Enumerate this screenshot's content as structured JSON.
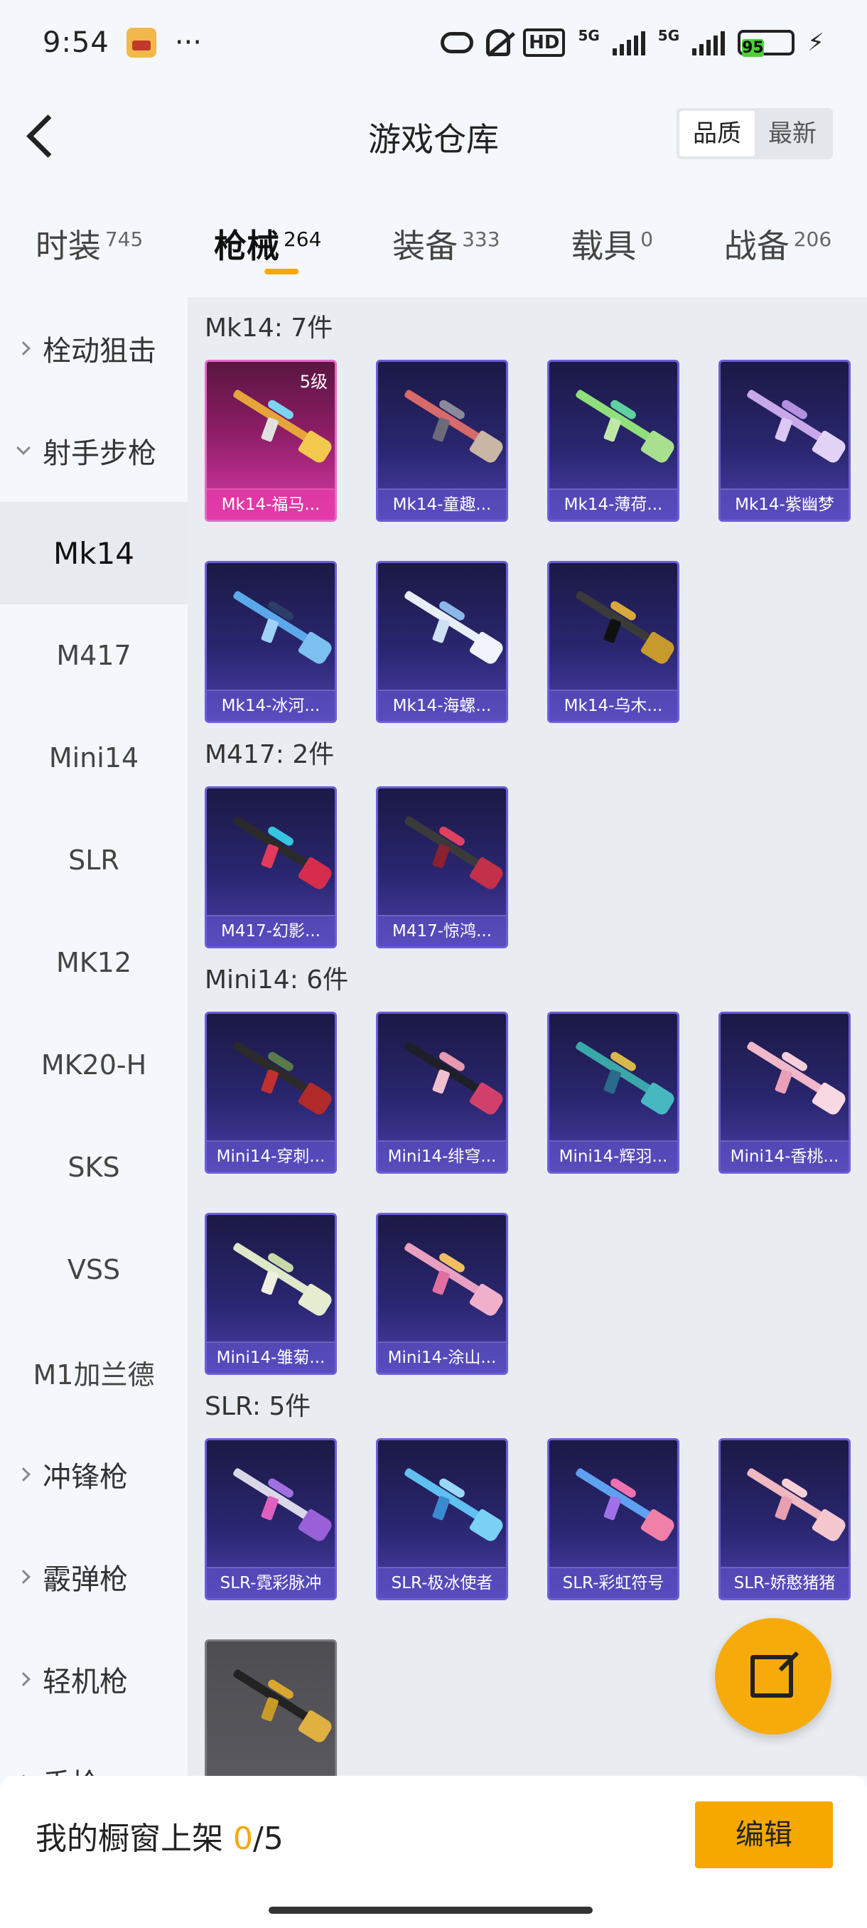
{
  "status_bar": {
    "time": "9:54",
    "dots": "···",
    "net": "5G",
    "battery": "95"
  },
  "header": {
    "title": "游戏仓库",
    "sort": [
      "品质",
      "最新"
    ]
  },
  "tabs": [
    {
      "label": "时装",
      "count": "745"
    },
    {
      "label": "枪械",
      "count": "264"
    },
    {
      "label": "装备",
      "count": "333"
    },
    {
      "label": "载具",
      "count": "0"
    },
    {
      "label": "战备",
      "count": "206"
    }
  ],
  "sidebar": {
    "groups": [
      "栓动狙击",
      "射手步枪"
    ],
    "items": [
      "Mk14",
      "M417",
      "Mini14",
      "SLR",
      "MK12",
      "MK20-H",
      "SKS",
      "VSS",
      "M1加兰德"
    ],
    "more_groups": [
      "冲锋枪",
      "霰弹枪",
      "轻机枪",
      "手枪"
    ]
  },
  "sections": [
    {
      "title": "Mk14: 7件",
      "items": [
        {
          "name": "Mk14-福马...",
          "level": "5级"
        },
        {
          "name": "Mk14-童趣..."
        },
        {
          "name": "Mk14-薄荷..."
        },
        {
          "name": "Mk14-紫幽梦"
        },
        {
          "name": "Mk14-冰河..."
        },
        {
          "name": "Mk14-海螺..."
        },
        {
          "name": "Mk14-乌木..."
        }
      ]
    },
    {
      "title": "M417: 2件",
      "items": [
        {
          "name": "M417-幻影..."
        },
        {
          "name": "M417-惊鸿..."
        }
      ]
    },
    {
      "title": "Mini14: 6件",
      "items": [
        {
          "name": "Mini14-穿刺..."
        },
        {
          "name": "Mini14-绯穹..."
        },
        {
          "name": "Mini14-辉羽..."
        },
        {
          "name": "Mini14-香桃..."
        },
        {
          "name": "Mini14-雏菊..."
        },
        {
          "name": "Mini14-涂山..."
        }
      ]
    },
    {
      "title": "SLR: 5件",
      "items": [
        {
          "name": "SLR-霓彩脉冲"
        },
        {
          "name": "SLR-极冰使者"
        },
        {
          "name": "SLR-彩虹符号"
        },
        {
          "name": "SLR-娇憨猪猪"
        },
        {
          "name": ""
        }
      ]
    }
  ],
  "bottom_bar": {
    "label": "我的橱窗上架",
    "used": "0",
    "total": "/5",
    "edit": "编辑"
  },
  "colors": {
    "accent": "#f6a800",
    "card_purple": "#2a2670",
    "card_pink": "#d93aa8"
  }
}
